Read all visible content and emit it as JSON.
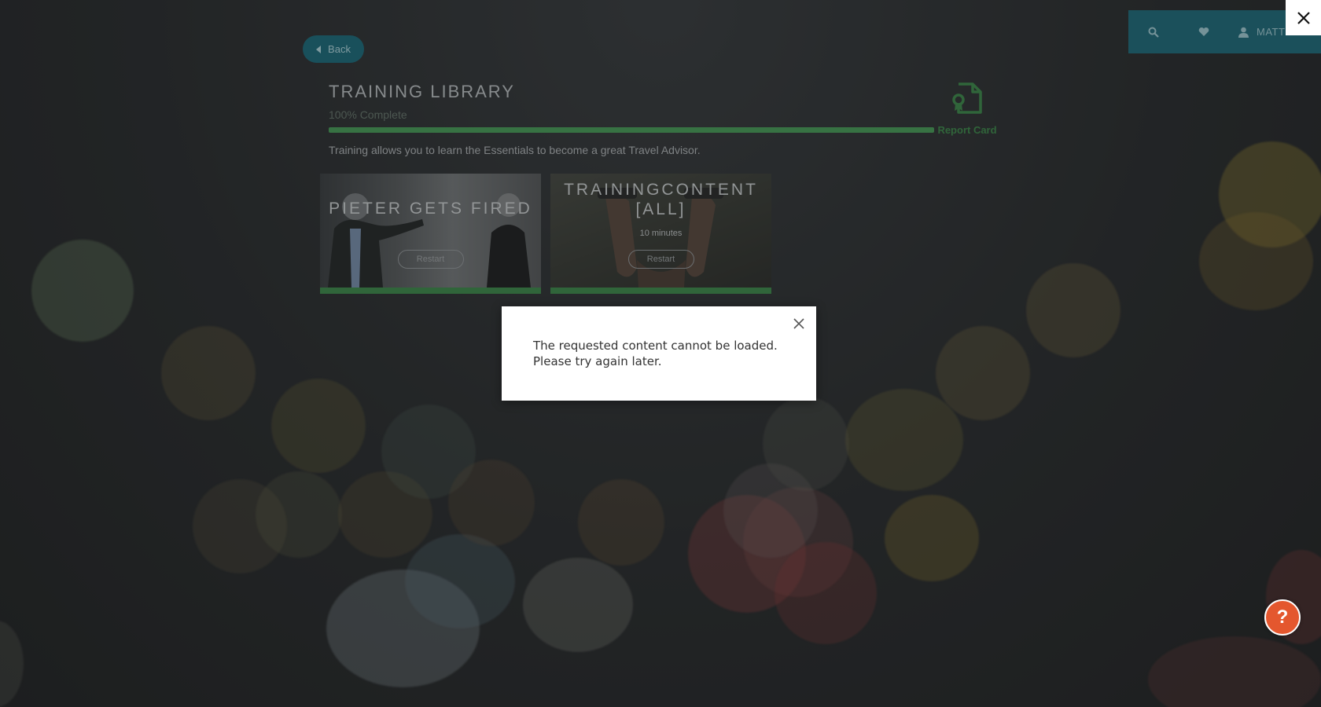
{
  "nav": {
    "user_label": "MATTEN",
    "icons": [
      "search-icon",
      "heart-icon",
      "user-icon"
    ]
  },
  "back": {
    "label": "Back",
    "icon": "chevron-left-icon"
  },
  "library": {
    "title": "TRAINING LIBRARY",
    "percent_label": "100% Complete",
    "progress_fraction": 1.0,
    "description": "Training allows you to learn the Essentials to become a great Travel Advisor."
  },
  "report_card": {
    "label": "Report Card",
    "icon": "certificate-file-icon"
  },
  "cards": [
    {
      "title": "PIETER GETS FIRED",
      "duration": "",
      "button": "Restart"
    },
    {
      "title": "TRAININGCONTENT [ALL]",
      "duration": "10 minutes",
      "button": "Restart"
    }
  ],
  "modal": {
    "message": "The requested content cannot be loaded. Please try again later.",
    "close_icon": "close-icon"
  },
  "lightbox_close_icon": "close-icon",
  "help": {
    "label": "?"
  },
  "colors": {
    "accent_teal": "#1f6f80",
    "progress_green": "#4aa35b",
    "help_orange": "#e4572e"
  }
}
